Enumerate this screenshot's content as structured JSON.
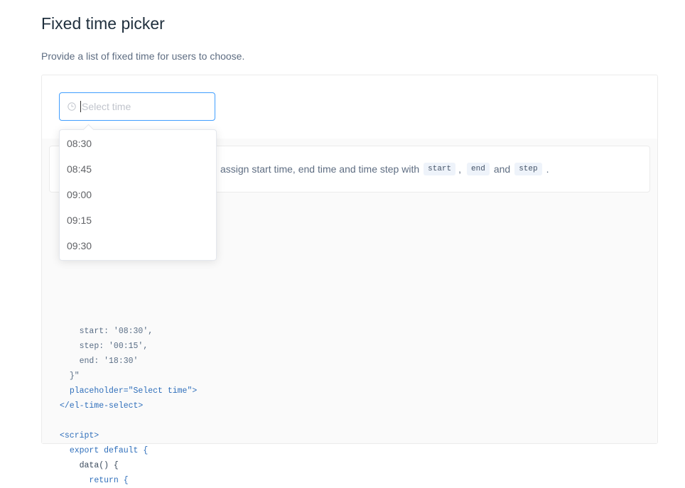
{
  "page": {
    "title": "Fixed time picker",
    "description": "Provide a list of fixed time for users to choose."
  },
  "time_input": {
    "placeholder": "Select time",
    "icon": "clock-icon"
  },
  "dropdown": {
    "options": [
      "08:30",
      "08:45",
      "09:00",
      "09:15",
      "09:30"
    ]
  },
  "tip": {
    "text_before": "assign start time, end time and time step with",
    "code_start": "start",
    "sep": ",",
    "code_end": "end",
    "and": "and",
    "code_step": "step",
    "period": "."
  },
  "code": {
    "line_start": "start: '08:30',",
    "line_step": "step: '00:15',",
    "line_end": "end: '18:30'",
    "line_close": "}\"",
    "line_placeholder": "placeholder=\"Select time\">",
    "line_close_tag": "</el-time-select>",
    "line_script": "<script>",
    "line_export": "export default {",
    "line_data": "data() {",
    "line_return": "return {"
  }
}
